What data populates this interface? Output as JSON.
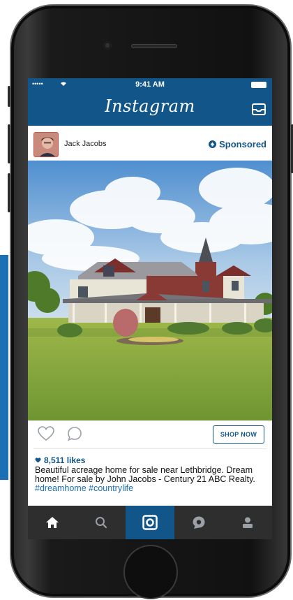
{
  "status_bar": {
    "signal": "•••••",
    "time": "9:41 AM"
  },
  "app": {
    "name": "Instagram"
  },
  "post": {
    "username": "Jack Jacobs",
    "sponsored_label": "Sponsored",
    "cta_label": "SHOP NOW",
    "likes": "8,511 likes",
    "caption_text": "Beautiful acreage home for sale near Lethbridge. Dream home! For sale by John Jacobs - Century 21 ABC Realty.",
    "hashtags": [
      "#dreamhome",
      "#countrylife"
    ]
  },
  "tab_bar": {
    "items": [
      {
        "name": "home",
        "icon": "home-icon",
        "active": false
      },
      {
        "name": "search",
        "icon": "search-icon",
        "active": false
      },
      {
        "name": "camera",
        "icon": "camera-icon",
        "active": true
      },
      {
        "name": "activity",
        "icon": "chat-bubble-icon",
        "active": false
      },
      {
        "name": "profile",
        "icon": "person-icon",
        "active": false
      }
    ]
  },
  "colors": {
    "brand_blue": "#125689",
    "tab_bar": "#2e2e2e",
    "hashtag": "#1b6fb5"
  }
}
